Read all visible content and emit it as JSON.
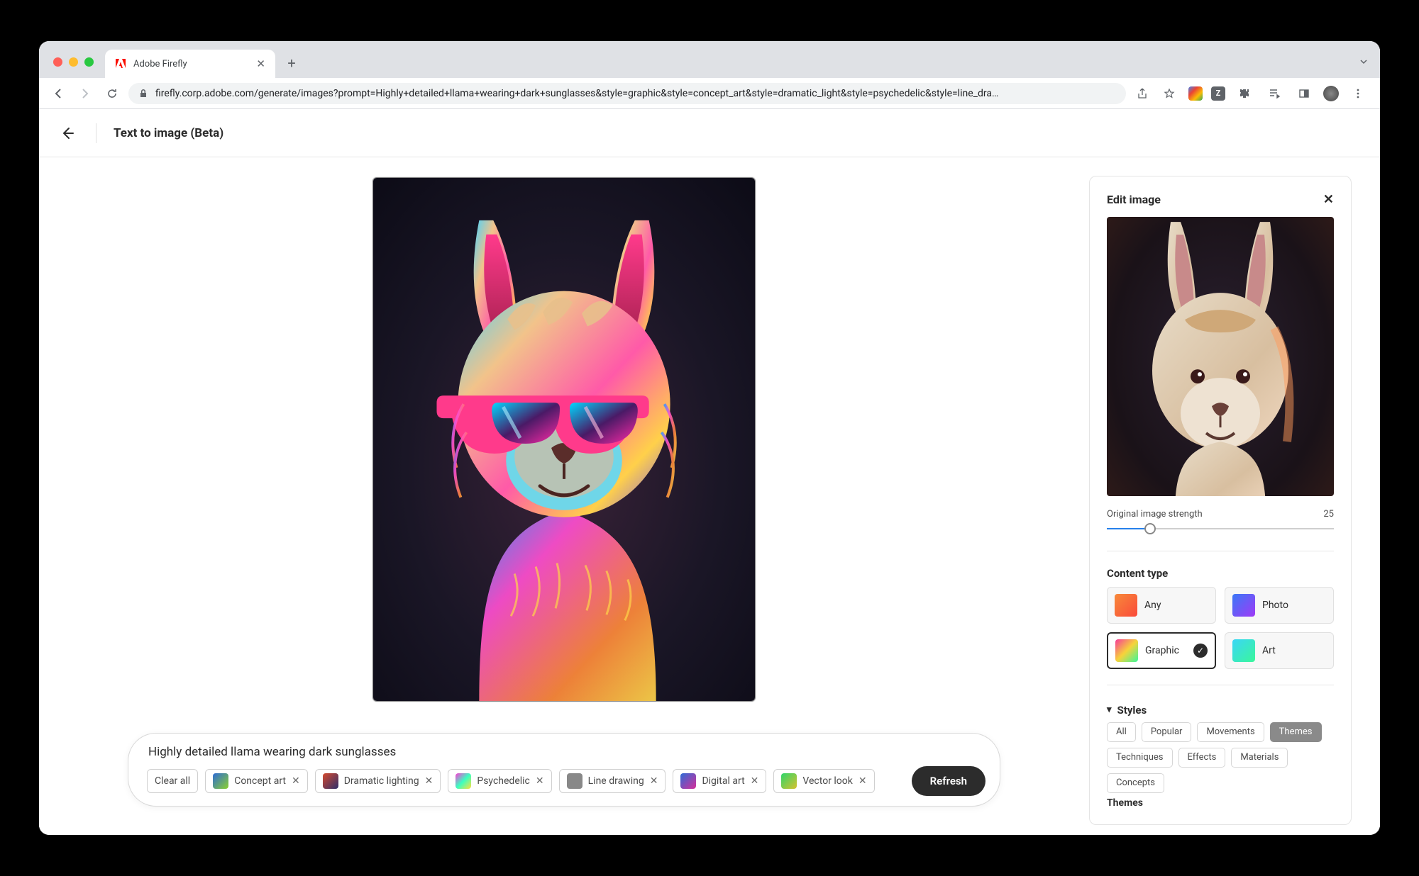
{
  "browser": {
    "tab_title": "Adobe Firefly",
    "url": "firefly.corp.adobe.com/generate/images?prompt=Highly+detailed+llama+wearing+dark+sunglasses&style=graphic&style=concept_art&style=dramatic_light&style=psychedelic&style=line_dra…"
  },
  "header": {
    "title": "Text to image (Beta)"
  },
  "prompt": {
    "text": "Highly detailed llama wearing dark sunglasses",
    "clear_all_label": "Clear all",
    "refresh_label": "Refresh",
    "styles": [
      "Concept art",
      "Dramatic lighting",
      "Psychedelic",
      "Line drawing",
      "Digital art",
      "Vector look"
    ]
  },
  "panel": {
    "title": "Edit image",
    "slider": {
      "label": "Original image strength",
      "value": 25
    },
    "content_type": {
      "title": "Content type",
      "options": [
        "Any",
        "Photo",
        "Graphic",
        "Art"
      ],
      "selected": "Graphic"
    },
    "styles": {
      "title": "Styles",
      "categories": [
        "All",
        "Popular",
        "Movements",
        "Themes",
        "Techniques",
        "Effects",
        "Materials",
        "Concepts"
      ],
      "active": "Themes",
      "section_label": "Themes"
    }
  }
}
